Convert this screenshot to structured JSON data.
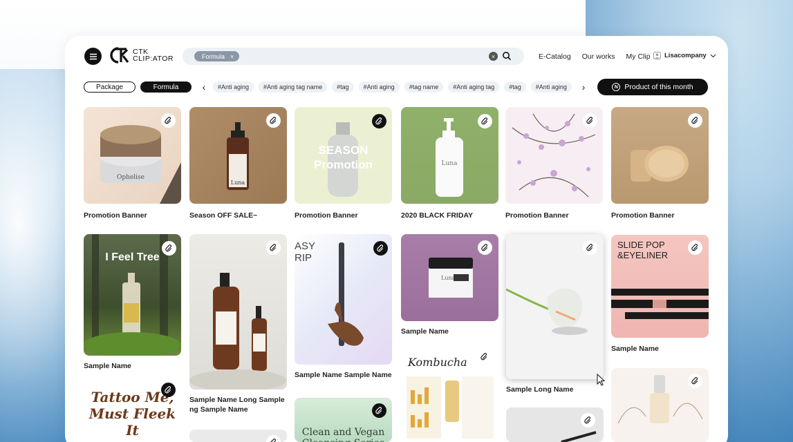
{
  "header": {
    "logo_line1": "CTK",
    "logo_line2": "CLIP:ATOR",
    "search_chip": "Formula",
    "links": [
      "E-Catalog",
      "Our works",
      "My Clip"
    ],
    "user": "Lisacompany"
  },
  "filters": {
    "package": "Package",
    "formula": "Formula",
    "tags": [
      "#Anti aging",
      "#Anti aging tag name",
      "#tag",
      "#Anti aging",
      "#tag name",
      "#Anti aging tag",
      "#tag",
      "#Anti aging"
    ],
    "product_month": "Product of this month",
    "product_month_badge": "N"
  },
  "cards": [
    {
      "name": "Promotion Banner",
      "overlay": "",
      "brand": "Ophelise"
    },
    {
      "name": "Season OFF SALE~",
      "overlay": "",
      "brand": "Luna"
    },
    {
      "name": "Promotion Banner",
      "overlay": "SEASON Promotion",
      "brand": ""
    },
    {
      "name": "2020 BLACK FRIDAY",
      "overlay": "",
      "brand": "Luna"
    },
    {
      "name": "Promotion Banner",
      "overlay": "",
      "brand": ""
    },
    {
      "name": "Promotion Banner",
      "overlay": "",
      "brand": ""
    },
    {
      "name": "Sample Name",
      "overlay": "I Feel Tree",
      "brand": ""
    },
    {
      "name": "Sample Name Long Sample ng Sample Name",
      "overlay": "",
      "brand": ""
    },
    {
      "name": "Sample Name Sample Name",
      "overlay": "ASY RIP",
      "brand": ""
    },
    {
      "name": "Sample Name",
      "overlay": "",
      "brand": "Luna"
    },
    {
      "name": "Sample Long Name",
      "overlay": "",
      "brand": ""
    },
    {
      "name": "Sample Name",
      "overlay": "SLIDE POP &EYELINER",
      "brand": ""
    },
    {
      "name": "",
      "overlay": "Tattoo Me, Must Fleek It",
      "brand": ""
    },
    {
      "name": "",
      "overlay": "Kombucha",
      "brand": ""
    },
    {
      "name": "",
      "overlay": "Clean and Vegan Cleansing Series",
      "brand": ""
    }
  ],
  "colors": {
    "accent": "#111111",
    "chip": "#8b97a6"
  }
}
